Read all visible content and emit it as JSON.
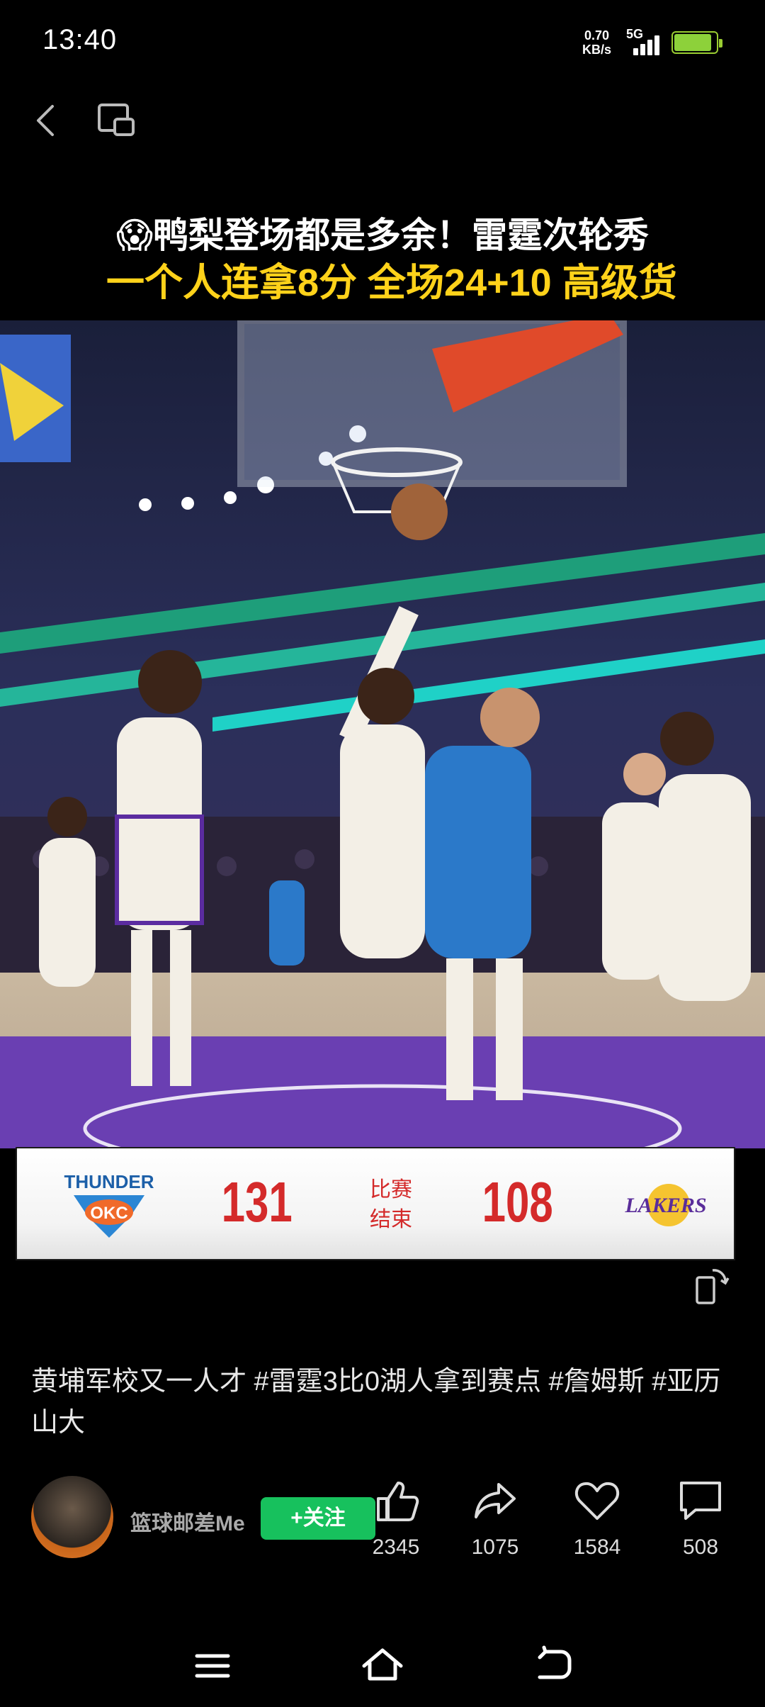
{
  "status_bar": {
    "time": "13:40",
    "net_speed_value": "0.70",
    "net_speed_unit": "KB/s",
    "network_type": "5G",
    "battery_level": 0.9,
    "battery_color": "#8dd13a"
  },
  "video": {
    "headline_line1": "鸭梨登场都是多余！雷霆次轮秀",
    "headline_emoji": "😱",
    "headline_line2": "一个人连拿8分 全场24+10 高级货",
    "scoreboard": {
      "home_team": "THUNDER",
      "home_score": "131",
      "status_line1": "比赛",
      "status_line2": "结束",
      "away_score": "108",
      "away_team": "LAKERS",
      "score_color": "#d42a2a"
    }
  },
  "description": "黄埔军校又一人才 #雷霆3比0湖人拿到赛点 #詹姆斯 #亚历山大",
  "author": {
    "name": "篮球邮差Me",
    "follow_label": "+关注",
    "follow_color": "#17c15d"
  },
  "actions": [
    {
      "icon": "thumbs-up-icon",
      "count": "2345"
    },
    {
      "icon": "share-icon",
      "count": "1075"
    },
    {
      "icon": "heart-icon",
      "count": "1584"
    },
    {
      "icon": "comment-icon",
      "count": "508"
    }
  ],
  "nav": [
    "menu-icon",
    "home-icon",
    "back-icon"
  ]
}
